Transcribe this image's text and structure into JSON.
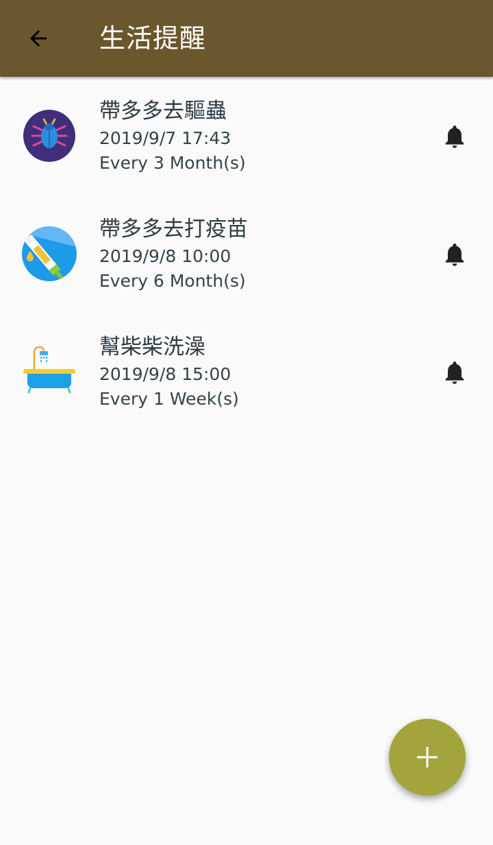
{
  "toolbar": {
    "title": "生活提醒",
    "background_color": "#6b572d",
    "back_icon": "arrow-back-icon"
  },
  "reminders": [
    {
      "name": "帶多多去驅蟲",
      "datetime": "2019/9/7 17:43",
      "repeat": "Every 3 Month(s)",
      "icon": "bug-icon",
      "bell_icon": "bell-icon"
    },
    {
      "name": "帶多多去打疫苗",
      "datetime": "2019/9/8 10:00",
      "repeat": "Every 6 Month(s)",
      "icon": "syringe-icon",
      "bell_icon": "bell-icon"
    },
    {
      "name": "幫柴柴洗澡",
      "datetime": "2019/9/8 15:00",
      "repeat": "Every 1 Week(s)",
      "icon": "bathtub-icon",
      "bell_icon": "bell-icon"
    }
  ],
  "fab": {
    "icon": "plus-icon",
    "color": "#a3a43c"
  }
}
